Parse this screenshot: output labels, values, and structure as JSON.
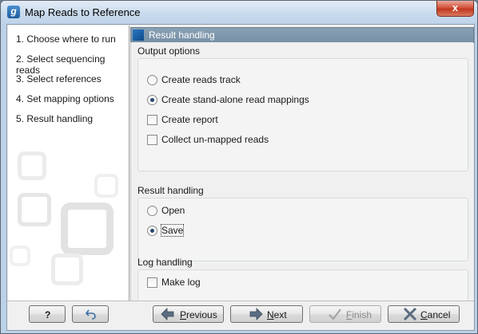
{
  "window": {
    "app_icon_letter": "g",
    "title": "Map Reads to Reference",
    "close_glyph": "x"
  },
  "steps": [
    {
      "label": "1.  Choose where to run"
    },
    {
      "label": "2.  Select sequencing reads"
    },
    {
      "label": "3.  Select references"
    },
    {
      "label": "4.  Set mapping options"
    },
    {
      "label": "5.  Result handling"
    }
  ],
  "panel": {
    "header": "Result handling"
  },
  "output_options": {
    "label": "Output options",
    "options": [
      {
        "type": "radio",
        "label": "Create reads track",
        "checked": false
      },
      {
        "type": "radio",
        "label": "Create stand-alone read mappings",
        "checked": true
      },
      {
        "type": "checkbox",
        "label": "Create report",
        "checked": false
      },
      {
        "type": "checkbox",
        "label": "Collect un-mapped reads",
        "checked": false
      }
    ]
  },
  "result_handling": {
    "label": "Result handling",
    "options": [
      {
        "type": "radio",
        "label": "Open",
        "checked": false
      },
      {
        "type": "radio",
        "label": "Save",
        "checked": true
      }
    ]
  },
  "log_handling": {
    "label": "Log handling",
    "options": [
      {
        "type": "checkbox",
        "label": "Make log",
        "checked": false
      }
    ]
  },
  "footer": {
    "help_label": "?",
    "previous": {
      "mnemonic": "P",
      "rest": "revious"
    },
    "next": {
      "mnemonic": "N",
      "rest": "ext"
    },
    "finish": {
      "mnemonic": "F",
      "rest": "inish",
      "enabled": false
    },
    "cancel": {
      "mnemonic": "C",
      "rest": "ancel"
    }
  },
  "colors": {
    "accent": "#2a77c4",
    "header_bg": "#8aa0b4",
    "close_red": "#c1391f"
  },
  "icons": [
    "app-logo-icon",
    "close-icon",
    "help-icon",
    "reset-icon",
    "previous-arrow-icon",
    "next-arrow-icon",
    "finish-check-icon",
    "cancel-x-icon"
  ]
}
